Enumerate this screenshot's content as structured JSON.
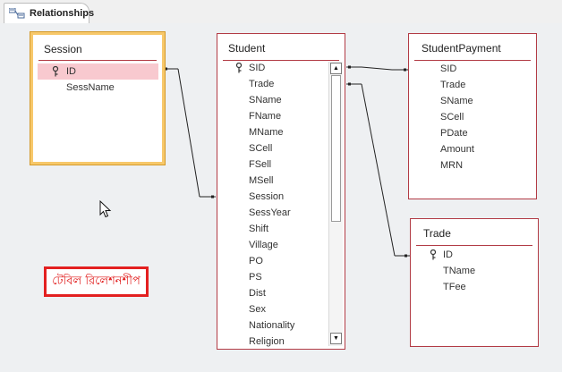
{
  "tab": {
    "label": "Relationships"
  },
  "note": "টেবিল রিলেশনশীপ",
  "tables": {
    "session": {
      "title": "Session",
      "fields": [
        "ID",
        "SessName"
      ],
      "key_field": "ID"
    },
    "student": {
      "title": "Student",
      "fields": [
        "SID",
        "Trade",
        "SName",
        "FName",
        "MName",
        "SCell",
        "FSell",
        "MSell",
        "Session",
        "SessYear",
        "Shift",
        "Village",
        "PO",
        "PS",
        "Dist",
        "Sex",
        "Nationality",
        "Religion"
      ],
      "key_field": "SID"
    },
    "studentpayment": {
      "title": "StudentPayment",
      "fields": [
        "SID",
        "Trade",
        "SName",
        "SCell",
        "PDate",
        "Amount",
        "MRN"
      ]
    },
    "trade": {
      "title": "Trade",
      "fields": [
        "ID",
        "TName",
        "TFee"
      ],
      "key_field": "ID"
    }
  },
  "colors": {
    "table_border": "#b23b45",
    "selected_border": "#f7c86b",
    "highlight_row": "#f8c9cf",
    "note_red": "#e32020"
  }
}
